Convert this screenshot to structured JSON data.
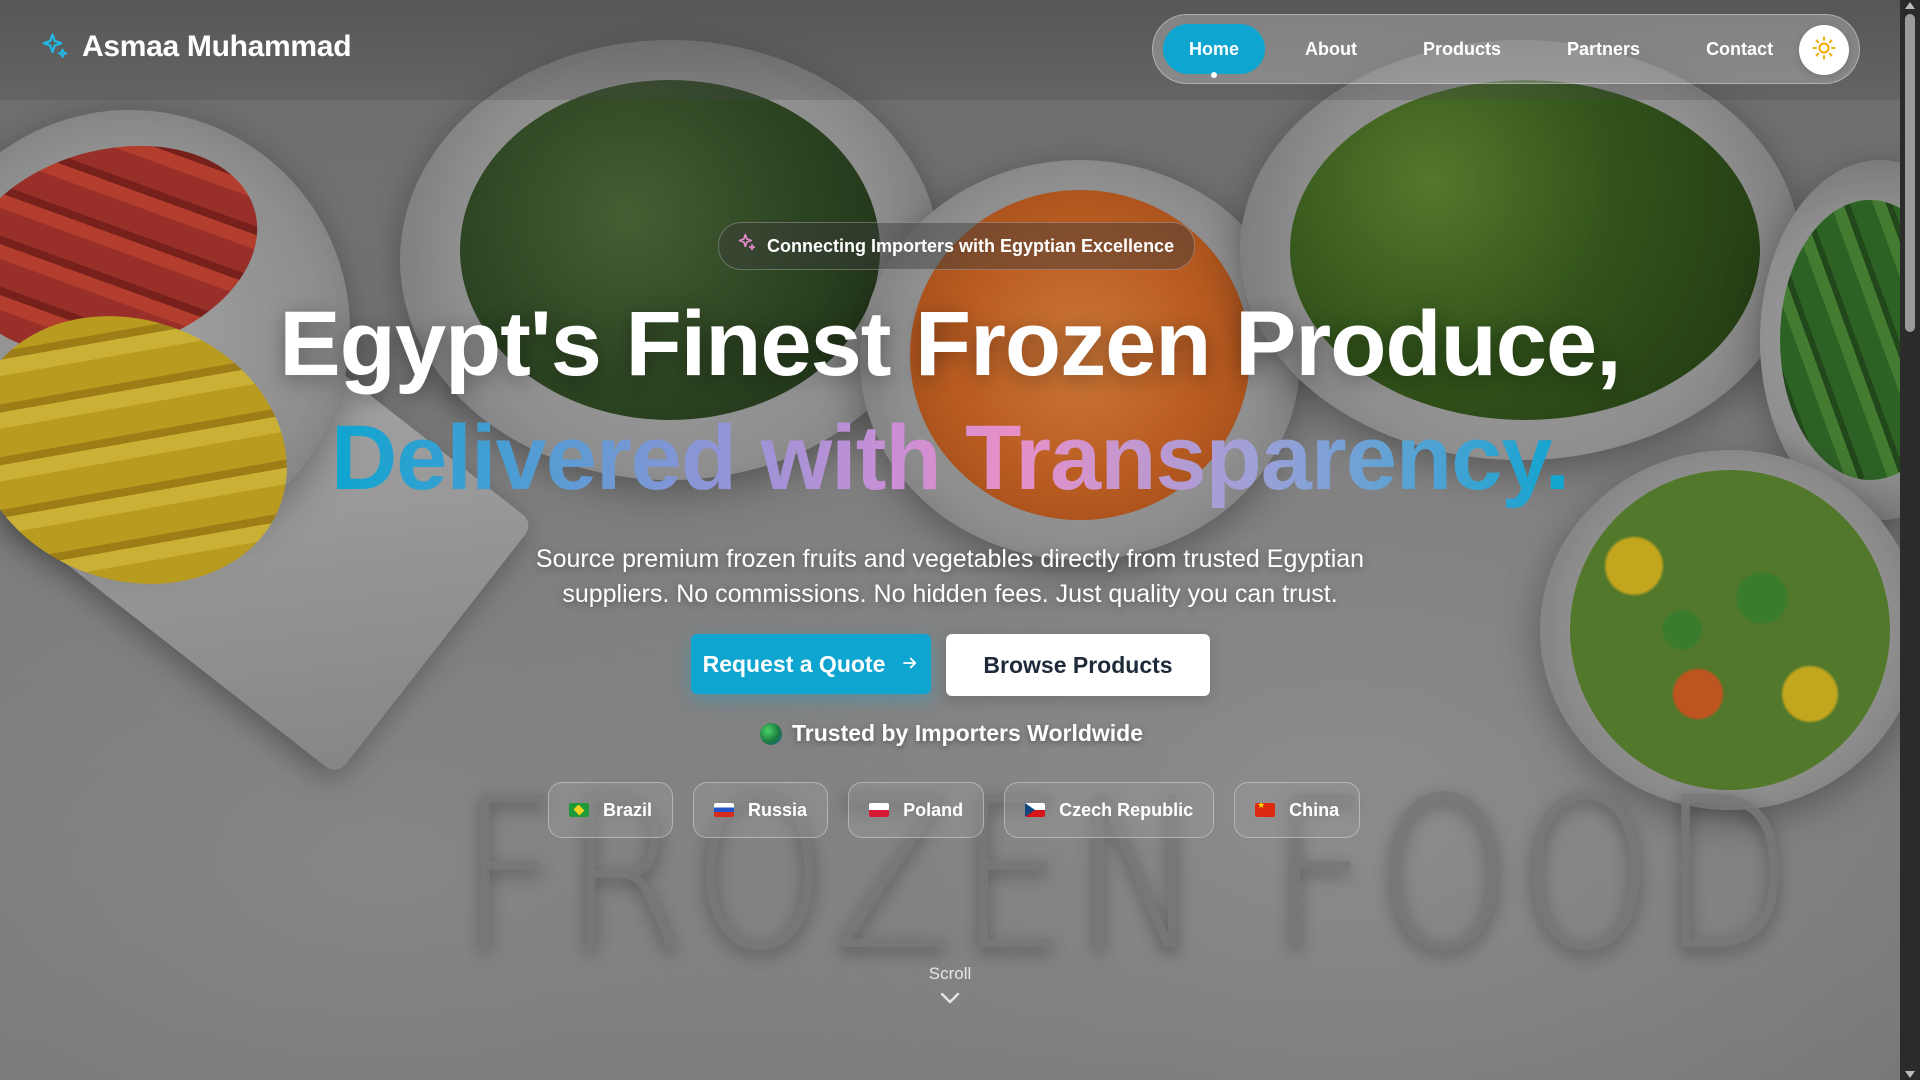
{
  "header": {
    "brand_name": "Asmaa Muhammad",
    "nav": [
      {
        "label": "Home",
        "active": true
      },
      {
        "label": "About",
        "active": false
      },
      {
        "label": "Products",
        "active": false
      },
      {
        "label": "Partners",
        "active": false
      },
      {
        "label": "Contact",
        "active": false
      }
    ],
    "theme_toggle_icon": "sun-icon"
  },
  "hero": {
    "badge": "Connecting Importers with Egyptian Excellence",
    "title_line1": "Egypt's Finest Frozen Produce,",
    "title_line2": "Delivered with Transparency.",
    "subtitle": "Source premium frozen fruits and vegetables directly from trusted Egyptian suppliers. No commissions. No hidden fees. Just quality you can trust.",
    "primary_button": "Request a Quote",
    "secondary_button": "Browse Products",
    "trusted_label": "Trusted by Importers Worldwide",
    "countries": [
      "Brazil",
      "Russia",
      "Poland",
      "Czech Republic",
      "China"
    ],
    "background_text": "FROZEN FOOD",
    "scroll_label": "Scroll"
  },
  "colors": {
    "accent": "#0ea5d0",
    "badge_icon": "#e98bd0",
    "brand_icon": "#22b8e6"
  }
}
